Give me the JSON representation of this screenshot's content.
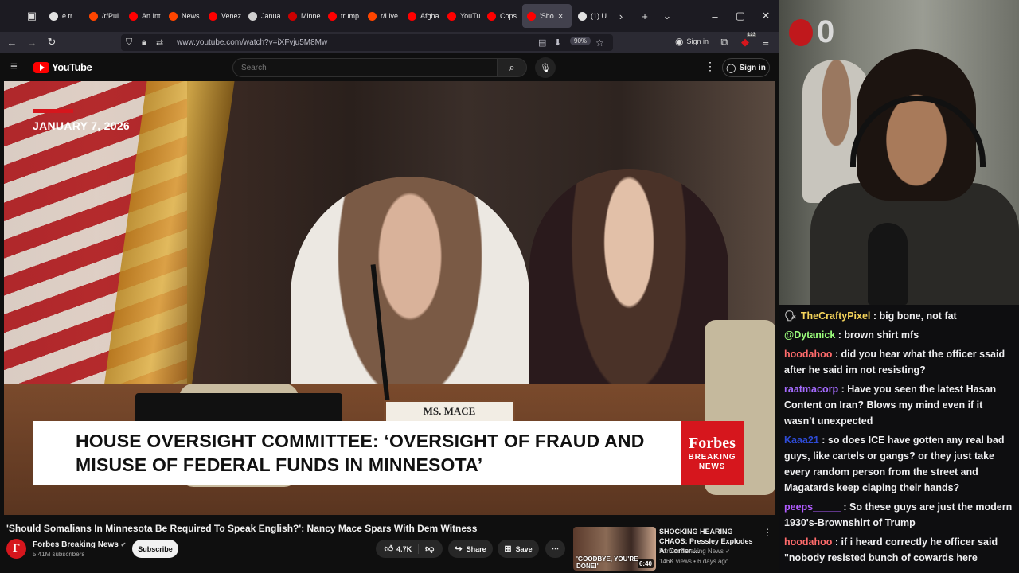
{
  "browser": {
    "tabs": [
      {
        "label": "e tr",
        "color": "#e2e2e2"
      },
      {
        "label": "/r/Pul",
        "color": "#ff4500"
      },
      {
        "label": "An Int",
        "color": "#ff0000"
      },
      {
        "label": "News",
        "color": "#ff4500"
      },
      {
        "label": "Venez",
        "color": "#ff0000"
      },
      {
        "label": "Janua",
        "color": "#cfcfcf"
      },
      {
        "label": "Minne",
        "color": "#cc0000"
      },
      {
        "label": "trump",
        "color": "#ff0000"
      },
      {
        "label": "r/Live",
        "color": "#ff4500"
      },
      {
        "label": "Afgha",
        "color": "#ff0000"
      },
      {
        "label": "YouTu",
        "color": "#ff0000"
      },
      {
        "label": "Cops",
        "color": "#ff0000"
      },
      {
        "label": "'Sho",
        "color": "#ff0000",
        "active": true
      },
      {
        "label": "(1) U",
        "color": "#e2e2e2"
      }
    ],
    "url": "www.youtube.com/watch?v=iXFvju5M8Mw",
    "zoom": "90%",
    "signin_label": "Sign in",
    "badge_count": "123"
  },
  "youtube": {
    "logo_text": "YouTube",
    "search_placeholder": "Search",
    "signin_label": "Sign in"
  },
  "video": {
    "date": "JANUARY 7, 2026",
    "nameplate": "MS. MACE",
    "lower_third": "HOUSE OVERSIGHT COMMITTEE: ‘OVERSIGHT OF FRAUD AND MISUSE OF FEDERAL FUNDS IN MINNESOTA’",
    "forbes_logo": "Forbes",
    "forbes_sub1": "BREAKING",
    "forbes_sub2": "NEWS",
    "title": "'Should Somalians In Minnesota Be Required To Speak English?': Nancy Mace Spars With Dem Witness",
    "channel_name": "Forbes Breaking News",
    "channel_initial": "F",
    "subscribers": "5.41M subscribers",
    "subscribe_label": "Subscribe",
    "likes": "4.7K",
    "share_label": "Share",
    "save_label": "Save"
  },
  "recommended": {
    "title": "SHOCKING HEARING CHAOS: Pressley Explodes At Comer ...",
    "channel": "Forbes Breaking News",
    "meta": "146K views • 6 days ago",
    "duration": "6:40",
    "thumb_text": "'GOODBYE, YOU'RE DONE!'"
  },
  "webcam": {
    "overlay_glyph": "0"
  },
  "chat": [
    {
      "user": "TheCraftyPixel",
      "color": "#f5d45b",
      "text": "big bone, not fat",
      "prefix": "🗣"
    },
    {
      "user": "@Dytanick",
      "color": "#9cff7c",
      "text": "brown shirt mfs"
    },
    {
      "user": "hoodahoo",
      "color": "#ff6b6b",
      "text": "did you hear what the officer ssaid after he said im not resisting?"
    },
    {
      "user": "raatmacorp",
      "color": "#a56bff",
      "text": "Have you seen the latest Hasan Content on Iran? Blows my mind even if it wasn't unexpected"
    },
    {
      "user": "Kaaa21",
      "color": "#2e4bd6",
      "text": "so does ICE have gotten any real bad guys, like cartels or gangs? or they just take every random person from the street and Magatards keep claping their hands?"
    },
    {
      "user": "peeps_____",
      "color": "#b05cff",
      "text": "So these guys are just the modern 1930's-Brownshirt of Trump"
    },
    {
      "user": "hoodahoo",
      "color": "#ff6b6b",
      "text": "if i heard correctly he officer said \"nobody resisted bunch of cowards here"
    }
  ]
}
